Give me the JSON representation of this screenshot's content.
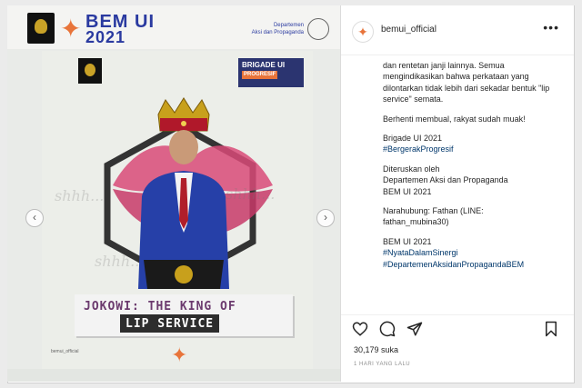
{
  "post_image": {
    "top_bar": {
      "org_title": "BEM UI",
      "org_year": "2021",
      "dept_label": "Departemen",
      "dept_sub": "Aksi dan Propaganda"
    },
    "brigade_badge": {
      "title": "BRIGADE UI",
      "tag": "PROGRESIF"
    },
    "poster_title_line1": "JOKOWI: THE KING OF",
    "poster_title_line2": "LIP SERVICE",
    "watermark": "shhh...",
    "footer_handle": "bemui_official",
    "nav_prev": "‹",
    "nav_next": "›"
  },
  "panel": {
    "username": "bemui_official",
    "more_label": "•••",
    "caption": [
      {
        "text": "dan rentetan janji lainnya. Semua mengindikasikan bahwa perkataan yang dilontarkan tidak lebih dari sekadar bentuk \"lip service\" semata.",
        "type": "text"
      },
      {
        "text": "Berhenti membual, rakyat sudah muak!",
        "type": "text"
      }
    ],
    "brigade_line": "Brigade UI 2021",
    "brigade_tag": "#BergerakProgresif",
    "forwarded_by": "Diteruskan oleh",
    "forwarded_dept": "Departemen Aksi dan Propaganda",
    "forwarded_org": "BEM UI 2021",
    "contact_label": "Narahubung: Fathan (LINE:",
    "contact_id": "fathan_mubina30)",
    "sign_org": "BEM UI 2021",
    "sign_tag1": "#NyataDalamSinergi",
    "sign_tag2": "#DepartemenAksidanPropagandaBEM",
    "likes": "30,179 suka",
    "time_ago": "1 HARI YANG LALU"
  },
  "colors": {
    "accent_orange": "#e8743a",
    "brand_blue": "#2a3aa0",
    "hashtag_blue": "#00376b"
  },
  "icons": [
    "heart-icon",
    "comment-icon",
    "share-icon",
    "bookmark-icon",
    "more-icon"
  ]
}
